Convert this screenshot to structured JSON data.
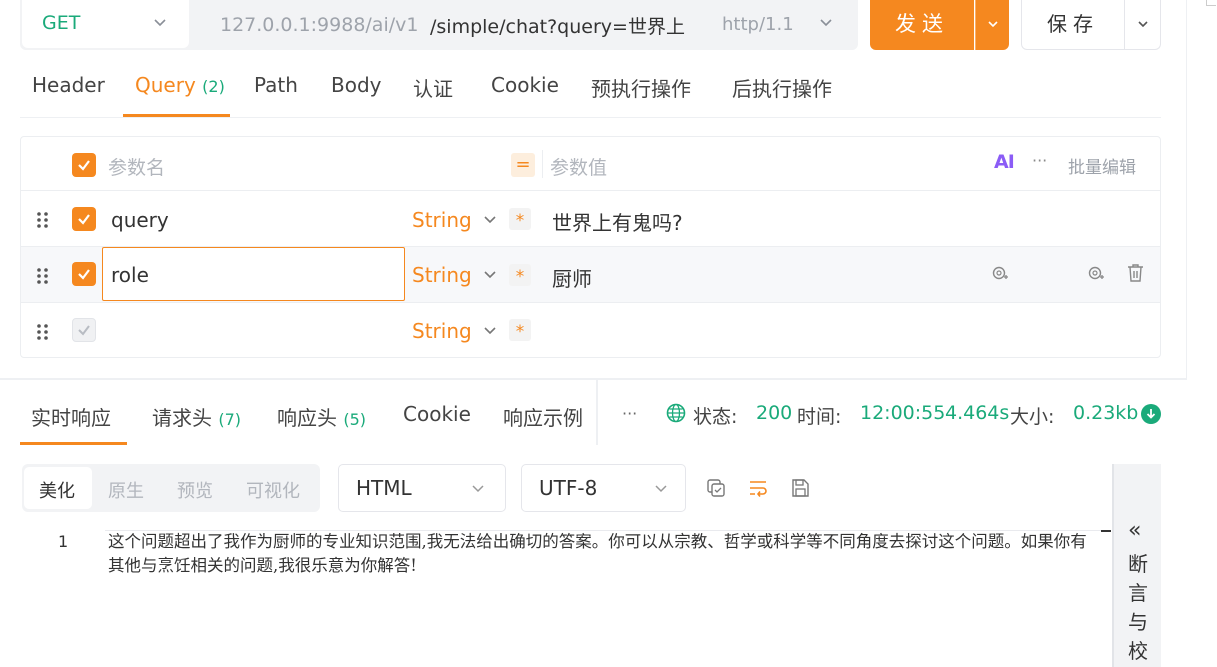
{
  "request": {
    "method": "GET",
    "url_host": "127.0.0.1:9988/ai/v1",
    "url_path": "/simple/chat?query=世界上",
    "protocol": "http/1.1",
    "send_label": "发送",
    "save_label": "保存"
  },
  "tabs": [
    {
      "label": "Header"
    },
    {
      "label": "Query",
      "count": "(2)"
    },
    {
      "label": "Path"
    },
    {
      "label": "Body"
    },
    {
      "label": "认证"
    },
    {
      "label": "Cookie"
    },
    {
      "label": "预执行操作"
    },
    {
      "label": "后执行操作"
    }
  ],
  "params": {
    "header_name": "参数名",
    "header_value": "参数值",
    "eq_symbol": "=",
    "ai_label": "AI",
    "more_label": "···",
    "batch_edit": "批量编辑",
    "required_mark": "*",
    "rows": [
      {
        "name": "query",
        "type": "String",
        "value": "世界上有鬼吗?"
      },
      {
        "name": "role",
        "type": "String",
        "value": "厨师"
      },
      {
        "name": "",
        "type": "String",
        "value": ""
      }
    ]
  },
  "response": {
    "tabs": [
      {
        "label": "实时响应"
      },
      {
        "label": "请求头",
        "count": "(7)"
      },
      {
        "label": "响应头",
        "count": "(5)"
      },
      {
        "label": "Cookie"
      },
      {
        "label": "响应示例"
      }
    ],
    "more_label": "···",
    "status_label": "状态:",
    "status_value": "200",
    "time_label": "时间:",
    "time_value": "12:00:55",
    "duration_value": "4.464s",
    "size_label": "大小:",
    "size_value": "0.23kb",
    "view_modes": [
      "美化",
      "原生",
      "预览",
      "可视化"
    ],
    "format": "HTML",
    "encoding": "UTF-8",
    "line_number": "1",
    "body": "这个问题超出了我作为厨师的专业知识范围,我无法给出确切的答案。你可以从宗教、哲学或科学等不同角度去探讨这个问题。如果你有其他与烹饪相关的问题,我很乐意为你解答!",
    "side_panel_chevron": "«",
    "side_panel_label": "断言与校验"
  },
  "colors": {
    "accent": "#f5881f",
    "success": "#1aaa7a"
  }
}
